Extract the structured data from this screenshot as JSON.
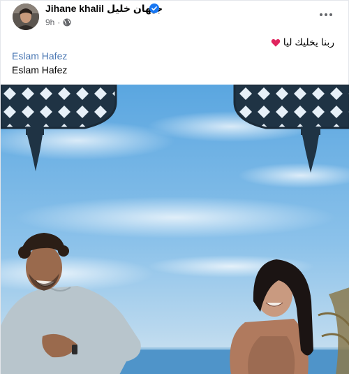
{
  "post": {
    "author_name": "Jihane khalil جيهان خليل",
    "timestamp": "9h",
    "separator": "·",
    "privacy_icon": "globe-icon",
    "verified_icon": "verified-badge-icon",
    "more_icon": "more-options-icon",
    "caption_text": "ربنا يخليك ليا",
    "caption_emoji": "heart-icon",
    "tag_link": "Eslam Hafez",
    "tag_text": "Eslam Hafez",
    "photo_icon": "post-photo"
  },
  "colors": {
    "link": "#4a77b3",
    "verified": "#1877f2",
    "heart": "#e0245e",
    "sky": "#6fb3e6"
  }
}
